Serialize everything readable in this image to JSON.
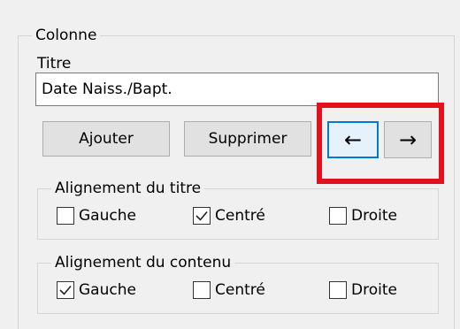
{
  "colonne_group": {
    "legend": "Colonne",
    "title_label": "Titre",
    "title_value": "Date Naiss./Bapt."
  },
  "buttons": {
    "add_label": "Ajouter",
    "delete_label": "Supprimer",
    "move_left_glyph": "←",
    "move_right_glyph": "→"
  },
  "title_alignment": {
    "legend": "Alignement du titre",
    "options": [
      {
        "label": "Gauche",
        "checked": false
      },
      {
        "label": "Centré",
        "checked": true
      },
      {
        "label": "Droite",
        "checked": false
      }
    ]
  },
  "content_alignment": {
    "legend": "Alignement du contenu",
    "options": [
      {
        "label": "Gauche",
        "checked": true
      },
      {
        "label": "Centré",
        "checked": false
      },
      {
        "label": "Droite",
        "checked": false
      }
    ]
  },
  "colors": {
    "highlight": "#e4101c",
    "focus_border": "#0078d7"
  }
}
